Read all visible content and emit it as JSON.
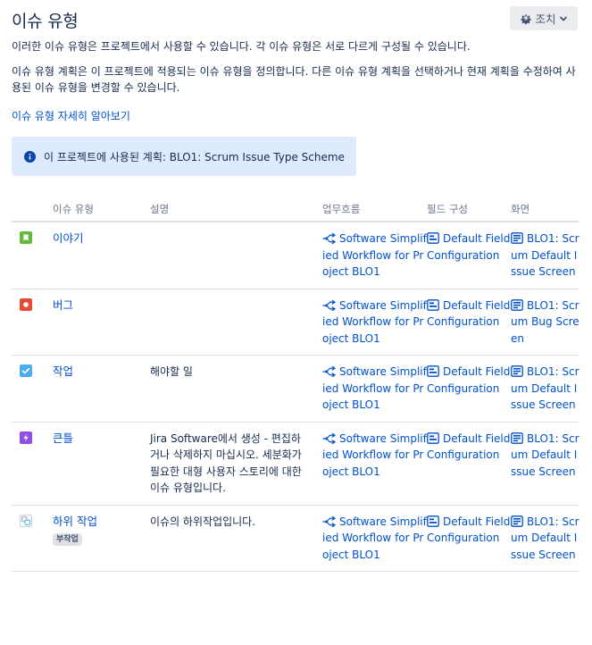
{
  "header": {
    "title": "이슈 유형",
    "actions_label": "조치"
  },
  "intro": {
    "line1": "이러한 이슈 유형은 프로젝트에서 사용할 수 있습니다. 각 이슈 유형은 서로 다르게 구성될 수 있습니다.",
    "line2": "이슈 유형 계획은 이 프로젝트에 적용되는 이슈 유형을 정의합니다. 다른 이슈 유형 계획을 선택하거나 현재 계획을 수정하여 사용된 이슈 유형을 변경할 수 있습니다.",
    "learn_more": "이슈 유형 자세히 알아보기"
  },
  "info": {
    "text": "이 프로젝트에 사용된 계획: BLO1: Scrum Issue Type Scheme"
  },
  "table": {
    "headers": {
      "type": "이슈 유형",
      "description": "설명",
      "workflow": "업무흐름",
      "field_config": "필드 구성",
      "screen": "화면"
    },
    "rows": [
      {
        "icon": "story-icon",
        "icon_color": "#63ba3c",
        "name": "이야기",
        "badge": "",
        "description": "",
        "workflow": "Software Simplified Workflow for Project BLO1",
        "field_config": "Default Field Configuration",
        "screen": "BLO1: Scrum Default Issue Screen"
      },
      {
        "icon": "bug-icon",
        "icon_color": "#e5493a",
        "name": "버그",
        "badge": "",
        "description": "",
        "workflow": "Software Simplified Workflow for Project BLO1",
        "field_config": "Default Field Configuration",
        "screen": "BLO1: Scrum Bug Screen"
      },
      {
        "icon": "task-icon",
        "icon_color": "#4bade8",
        "name": "작업",
        "badge": "",
        "description": "해야할 일",
        "workflow": "Software Simplified Workflow for Project BLO1",
        "field_config": "Default Field Configuration",
        "screen": "BLO1: Scrum Default Issue Screen"
      },
      {
        "icon": "epic-icon",
        "icon_color": "#904ee2",
        "name": "큰틀",
        "badge": "",
        "description": "Jira Software에서 생성 - 편집하거나 삭제하지 마십시오. 세분화가 필요한 대형 사용자 스토리에 대한 이슈 유형입니다.",
        "workflow": "Software Simplified Workflow for Project BLO1",
        "field_config": "Default Field Configuration",
        "screen": "BLO1: Scrum Default Issue Screen"
      },
      {
        "icon": "subtask-icon",
        "icon_color": "#4bade8",
        "name": "하위 작업",
        "badge": "부작업",
        "description": "이슈의 하위작업입니다.",
        "workflow": "Software Simplified Workflow for Project BLO1",
        "field_config": "Default Field Configuration",
        "screen": "BLO1: Scrum Default Issue Screen"
      }
    ]
  }
}
